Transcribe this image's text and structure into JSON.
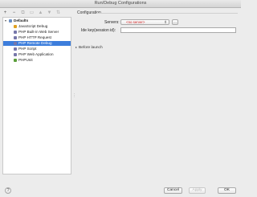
{
  "window": {
    "title": "Run/Debug Configurations"
  },
  "toolbar": {
    "items": [
      {
        "icon": "plus-icon",
        "glyph": "+"
      },
      {
        "icon": "minus-icon",
        "glyph": "−"
      },
      {
        "icon": "copy-icon",
        "glyph": "⧉"
      },
      {
        "icon": "folder-icon",
        "glyph": "▭"
      },
      {
        "icon": "arrow-up-icon",
        "glyph": "▲"
      },
      {
        "icon": "arrow-down-icon",
        "glyph": "▼"
      },
      {
        "icon": "sort-icon",
        "glyph": "⇅"
      }
    ]
  },
  "sidebar": {
    "tree": [
      {
        "label": "Defaults",
        "icon": "defaults-icon",
        "color": "#6b8fc4",
        "bold": true
      },
      {
        "label": "JavaScript Debug",
        "icon": "javascript-debug-icon",
        "color": "#e0a020"
      },
      {
        "label": "PHP Built-in Web Server",
        "icon": "php-builtin-server-icon",
        "color": "#7777aa"
      },
      {
        "label": "PHP HTTP Request",
        "icon": "php-http-request-icon",
        "color": "#7777aa"
      },
      {
        "label": "PHP Remote Debug",
        "icon": "php-remote-debug-icon",
        "color": "#7777aa",
        "selected": true
      },
      {
        "label": "PHP Script",
        "icon": "php-script-icon",
        "color": "#7777aa"
      },
      {
        "label": "PHP Web Application",
        "icon": "php-web-application-icon",
        "color": "#7777aa"
      },
      {
        "label": "PHPUnit",
        "icon": "phpunit-icon",
        "color": "#5a9e3a"
      }
    ]
  },
  "main": {
    "section_title": "Configuration",
    "servers_label": "Servers:",
    "servers_value": "<no server>",
    "servers_button": "...",
    "ide_key_label": "Ide key(session id):",
    "ide_key_value": "",
    "before_launch": "Before launch"
  },
  "footer": {
    "help": "?",
    "cancel": "Cancel",
    "apply": "Apply",
    "ok": "OK"
  }
}
